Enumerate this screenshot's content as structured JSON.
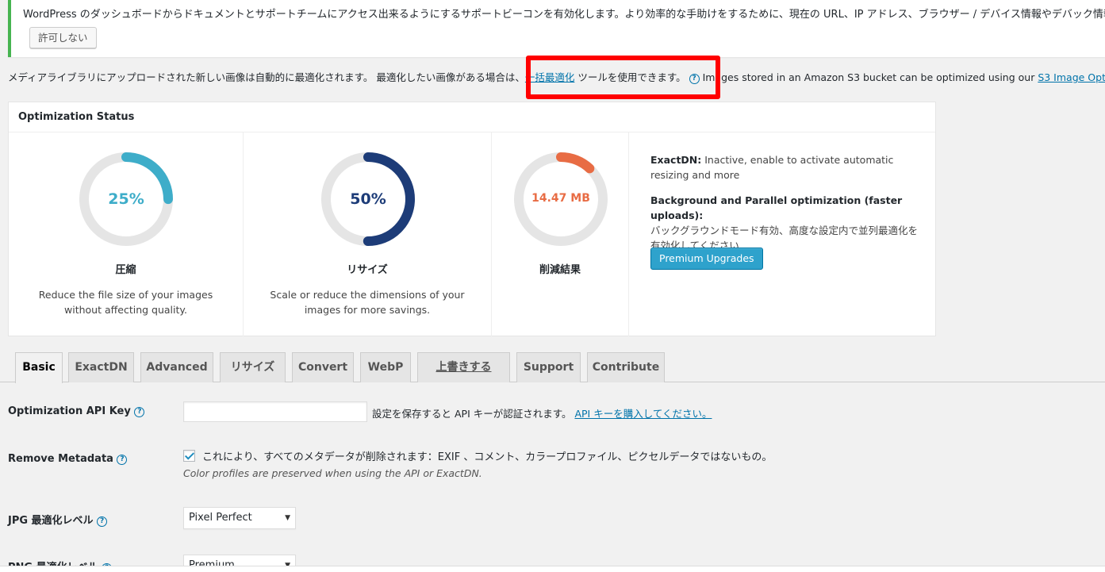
{
  "notice": {
    "text": "WordPress のダッシュボードからドキュメントとサポートチームにアクセス出来るようにするサポートビーコンを有効化します。より効率的な手助けをするために、現在の URL、IP アドレス、ブラウザー / デバイス情報やデバック情報",
    "deny_label": "許可しない"
  },
  "info": {
    "text_before": "メディアライブラリにアップロードされた新しい画像は自動的に最適化されます。 最適化したい画像がある場合は、",
    "link": "一括最適化",
    "text_after": " ツールを使用できます。",
    "s3_text": " Images stored in an Amazon S3 bucket can be optimized using our ",
    "s3_link": "S3 Image Opt"
  },
  "status": {
    "title": "Optimization Status",
    "compress": {
      "value": "25%",
      "fraction": 0.25,
      "title": "圧縮",
      "desc1": "Reduce the file size of your images",
      "desc2": "without affecting quality.",
      "color": "#3eadc9"
    },
    "resize": {
      "value": "50%",
      "fraction": 0.5,
      "title": "リサイズ",
      "desc1": "Scale or reduce the dimensions of your",
      "desc2": "images for more savings.",
      "color": "#1d3c78"
    },
    "savings": {
      "value": "14.47 MB",
      "fraction": 0.12,
      "title": "削減結果",
      "color": "#e86c44"
    },
    "exactdn_label": "ExactDN:",
    "exactdn_text": " Inactive, enable to activate automatic resizing and more",
    "bg_label": "Background and Parallel optimization (faster uploads):",
    "bg_text": "バックグラウンドモード有効、高度な設定内で並列最適化を有効化してください",
    "premium_label": "Premium Upgrades"
  },
  "tabs": [
    "Basic",
    "ExactDN",
    "Advanced",
    "リサイズ",
    "Convert",
    "WebP",
    "上書きする",
    "Support",
    "Contribute"
  ],
  "settings": {
    "api_key_label": "Optimization API Key",
    "api_key_value": "",
    "api_desc": "設定を保存すると API キーが認証されます。 ",
    "api_link": "API キーを購入してください。",
    "metadata_label": "Remove Metadata",
    "metadata_check": "これにより、すべてのメタデータが削除されます：EXIF 、コメント、カラープロファイル、ピクセルデータではないもの。",
    "metadata_note": "Color profiles are preserved when using the API or ExactDN.",
    "jpg_label": "JPG 最適化レベル",
    "jpg_value": "Pixel Perfect",
    "png_label": "PNG 最適化レベル",
    "png_value": "Premium"
  }
}
